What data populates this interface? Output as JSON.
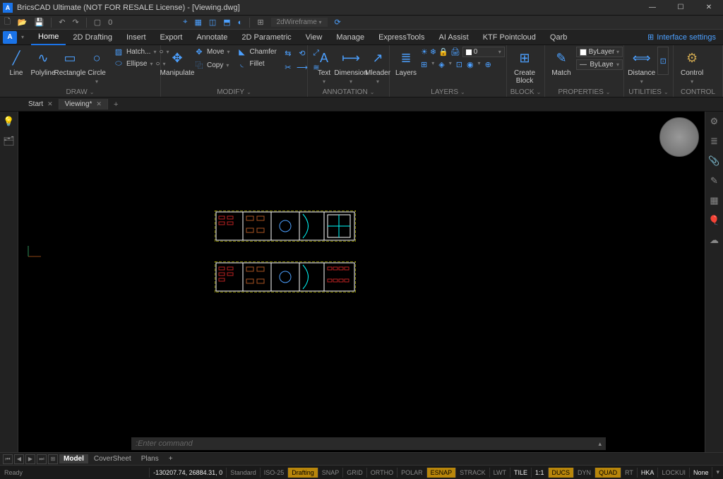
{
  "title": "BricsCAD Ultimate (NOT FOR RESALE License) - [Viewing.dwg]",
  "qat": {
    "visual_style": "2dWireframe",
    "counter": "0"
  },
  "tabs": [
    "Home",
    "2D Drafting",
    "Insert",
    "Export",
    "Annotate",
    "2D Parametric",
    "View",
    "Manage",
    "ExpressTools",
    "AI Assist",
    "KTF Pointcloud",
    "Qarb"
  ],
  "active_tab": "Home",
  "interface_settings": "Interface settings",
  "ribbon": {
    "draw": {
      "title": "DRAW",
      "line": "Line",
      "polyline": "Polyline",
      "rectangle": "Rectangle",
      "circle": "Circle",
      "hatch": "Hatch...",
      "ellipse": "Ellipse"
    },
    "modify": {
      "title": "MODIFY",
      "manipulate": "Manipulate",
      "move": "Move",
      "copy": "Copy",
      "chamfer": "Chamfer",
      "fillet": "Fillet"
    },
    "annotation": {
      "title": "ANNOTATION",
      "text": "Text",
      "dimension": "Dimension",
      "mleader": "Mleader"
    },
    "layers": {
      "title": "LAYERS",
      "layers": "Layers",
      "value": "0"
    },
    "block": {
      "title": "BLOCK",
      "create": "Create\nBlock"
    },
    "properties": {
      "title": "PROPERTIES",
      "match": "Match",
      "bylayer1": "ByLayer",
      "bylayer2": "ByLaye"
    },
    "utilities": {
      "title": "UTILITIES",
      "distance": "Distance"
    },
    "control": {
      "title": "CONTROL",
      "control": "Control"
    }
  },
  "doc_tabs": {
    "start": "Start",
    "viewing": "Viewing*"
  },
  "cmd": {
    "prompt": ": ",
    "placeholder": "Enter command"
  },
  "layout": {
    "model": "Model",
    "cover": "CoverSheet",
    "plans": "Plans"
  },
  "status": {
    "ready": "Ready",
    "coords": "-130207.74, 26884.31, 0",
    "standard": "Standard",
    "iso": "ISO-25",
    "drafting": "Drafting",
    "snap": "SNAP",
    "grid": "GRID",
    "ortho": "ORTHO",
    "polar": "POLAR",
    "esnap": "ESNAP",
    "strack": "STRACK",
    "lwt": "LWT",
    "tile": "TILE",
    "scale": "1:1",
    "ducs": "DUCS",
    "dyn": "DYN",
    "quad": "QUAD",
    "rt": "RT",
    "hka": "HKA",
    "lockui": "LOCKUI",
    "none": "None"
  }
}
